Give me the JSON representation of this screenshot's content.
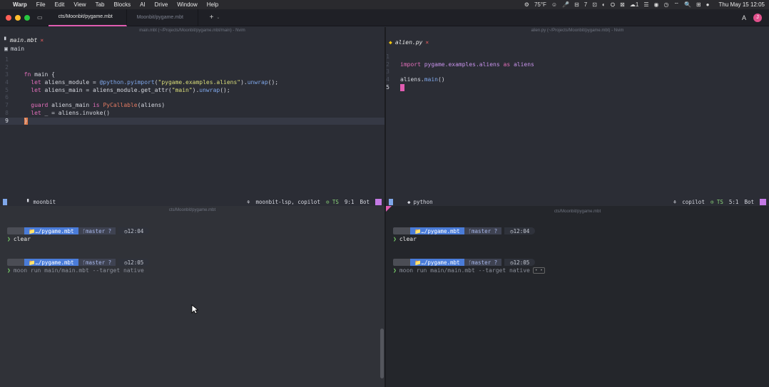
{
  "menubar": {
    "items": [
      "Warp",
      "File",
      "Edit",
      "View",
      "Tab",
      "Blocks",
      "AI",
      "Drive",
      "Window",
      "Help"
    ],
    "status_right": [
      "⚙",
      "75°F",
      "☺",
      "🎤",
      "⊟",
      "7",
      "⊡",
      "◐",
      "⛭",
      "⊠",
      "☰",
      "◉",
      "◷",
      "⌔",
      "🔍",
      "⊞",
      "●"
    ],
    "chat_count": "1",
    "clock": "Thu May 15 12:05"
  },
  "tabs": [
    {
      "label": "cts/Moonbit/pygame.mbt"
    },
    {
      "label": "Moonbit/pygame.mbt"
    }
  ],
  "tab_add": "+",
  "tabbar_icons": {
    "ai": "A",
    "avatar": "J"
  },
  "vim_left": {
    "title": "main.mbt (~/Projects/Moonbit/pygame.mbt/main) - Nvim",
    "buffer_name": "main.mbt",
    "modified_mark": "×",
    "breadcrumb": "main",
    "lines": [
      {
        "n": "1",
        "code": ""
      },
      {
        "n": "2",
        "code": ""
      },
      {
        "n": "3",
        "code": "  fn main {"
      },
      {
        "n": "4",
        "code": "    let aliens_module = @python.pyimport(\"pygame.examples.aliens\").unwrap();"
      },
      {
        "n": "5",
        "code": "    let aliens_main = aliens_module.get_attr(\"main\").unwrap();"
      },
      {
        "n": "6",
        "code": ""
      },
      {
        "n": "7",
        "code": "    guard aliens_main is PyCallable(aliens)"
      },
      {
        "n": "8",
        "code": "    let _ = aliens.invoke()"
      },
      {
        "n": "9",
        "code": "  }"
      }
    ],
    "status": {
      "filename": "moonbit",
      "lsp": "moonbit-lsp, copilot",
      "ts": "TS",
      "position": "9:1",
      "scroll": "Bot"
    }
  },
  "vim_right": {
    "title": "alien.py (~/Projects/Moonbit/pygame.mbt) - Nvim",
    "buffer_name": "alien.py",
    "modified_mark": "×",
    "lines": [
      {
        "n": "1",
        "code": ""
      },
      {
        "n": "2",
        "code": "import pygame.examples.aliens as aliens"
      },
      {
        "n": "3",
        "code": ""
      },
      {
        "n": "4",
        "code": "aliens.main()"
      },
      {
        "n": "5",
        "code": ""
      }
    ],
    "status": {
      "filename": "python",
      "lsp": "copilot",
      "ts": "TS",
      "position": "5:1",
      "scroll": "Bot"
    }
  },
  "term_left": {
    "title": "cts/Moonbit/pygame.mbt",
    "blocks": [
      {
        "dir": "…/pygame.mbt",
        "git": "master ?",
        "time": "12:04",
        "cmd": "clear"
      },
      {
        "dir": "…/pygame.mbt",
        "git": "master ?",
        "time": "12:05",
        "cmd": "moon run main/main.mbt --target native"
      }
    ]
  },
  "term_right": {
    "title": "cts/Moonbit/pygame.mbt",
    "blocks": [
      {
        "dir": "…/pygame.mbt",
        "git": "master ?",
        "time": "12:04",
        "cmd": "clear"
      },
      {
        "dir": "…/pygame.mbt",
        "git": "master ?",
        "time": "12:05",
        "cmd": "moon run main/main.mbt --target native"
      }
    ],
    "spinner": "• •"
  },
  "colors": {
    "accent_pink": "#e05cb1",
    "directory_blue": "#4a7cd9",
    "prompt_green": "#7ad36a"
  }
}
